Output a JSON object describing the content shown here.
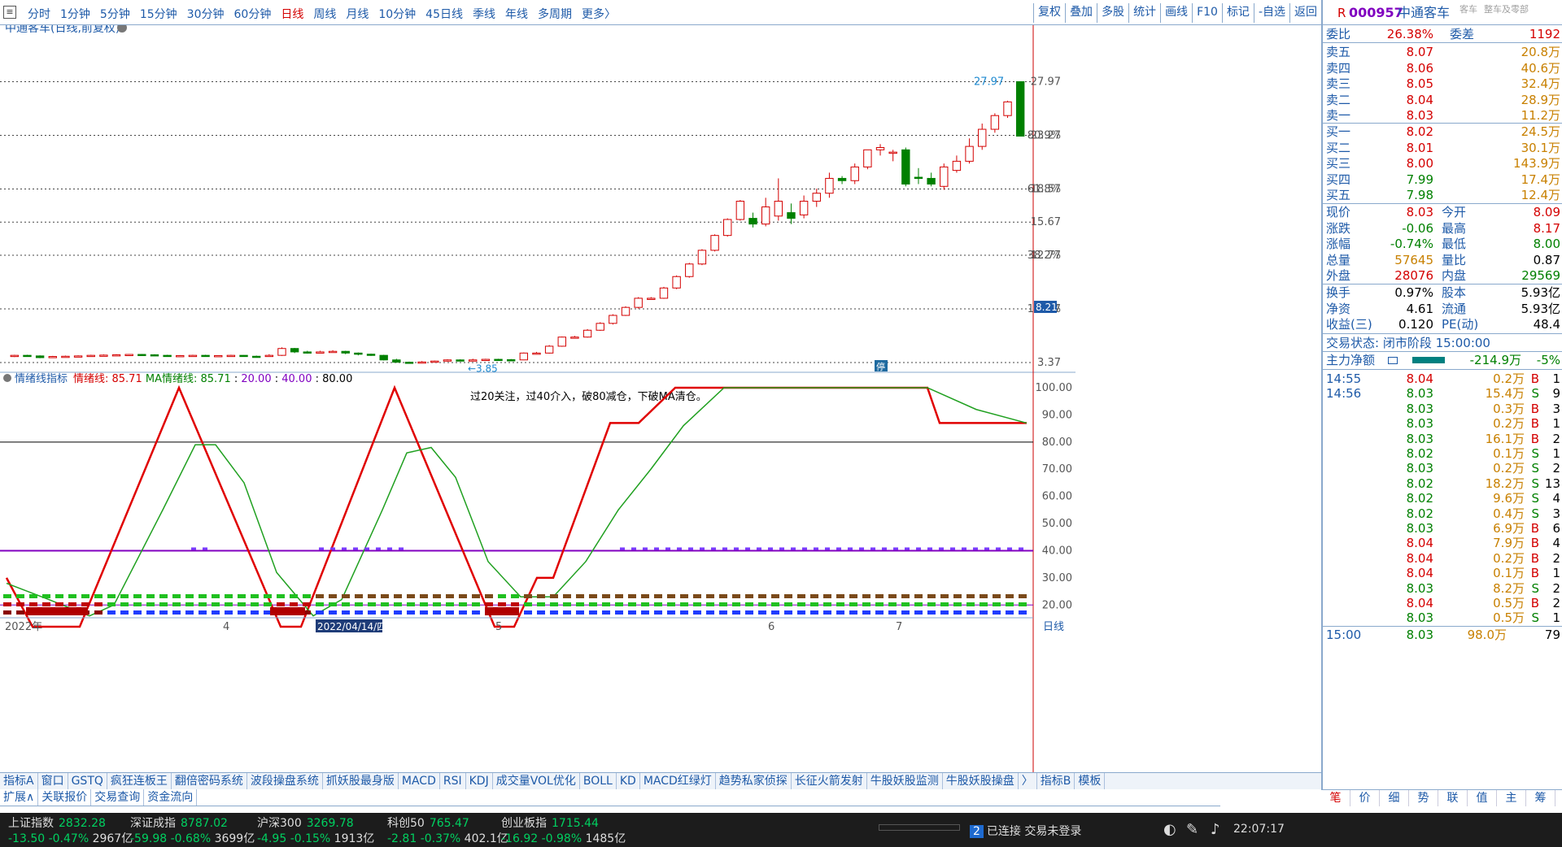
{
  "periods": [
    "分时",
    "1分钟",
    "5分钟",
    "15分钟",
    "30分钟",
    "60分钟",
    "日线",
    "周线",
    "月线",
    "10分钟",
    "45日线",
    "季线",
    "年线",
    "多周期",
    "更多〉"
  ],
  "active_period": "日线",
  "tools": [
    "复权",
    "叠加",
    "多股",
    "统计",
    "画线",
    "F10",
    "标记",
    "-自选",
    "返回"
  ],
  "chart_title": "中通客车(日线,前复权)",
  "price_axis": [
    "27.97",
    "23.27",
    "18.57",
    "15.67",
    "12.77",
    "8.07",
    "3.37"
  ],
  "pct_axis": [
    "80.9%",
    "61.8%",
    "38.2%",
    "19.1%"
  ],
  "current_price_tag": "8.21",
  "low_label": "3.85",
  "high_label": "27.97",
  "indicator": {
    "name": "情绪线指标",
    "l1": "情绪线:",
    "v1": "85.71",
    "l2": "MA情绪线:",
    "v2": "85.71",
    "lv3": "20.00",
    "lv4": "40.00",
    "lv5": "80.00",
    "note": "过20关注，过40介入，破80减仓，下破MA清仓。"
  },
  "ind_axis": [
    "100.00",
    "90.00",
    "80.00",
    "70.00",
    "60.00",
    "50.00",
    "40.00",
    "30.00",
    "20.00"
  ],
  "date_axis": {
    "year": "2022年",
    "m4": "4",
    "cursor": "2022/04/14/四",
    "m5": "5",
    "m6": "6",
    "m7": "7",
    "period": "日线"
  },
  "tabs1": [
    "指标A",
    "窗口",
    "GSTQ",
    "疯狂连板王",
    "翻倍密码系统",
    "波段操盘系统",
    "抓妖股最身版",
    "MACD",
    "RSI",
    "KDJ",
    "成交量VOL优化",
    "BOLL",
    "KD",
    "MACD红绿灯",
    "趋势私家侦探",
    "长征火箭发射",
    "牛股妖股监测",
    "牛股妖股操盘",
    "〉",
    "指标B",
    "模板"
  ],
  "tabs2": [
    "扩展∧",
    "关联报价",
    "交易查询",
    "资金流向"
  ],
  "rp_tabs": [
    "笔",
    "价",
    "细",
    "势",
    "联",
    "值",
    "主",
    "筹"
  ],
  "stock": {
    "code": "000957",
    "name": "中通客车",
    "tag1": "客车",
    "tag2": "整车及零部"
  },
  "weibi": {
    "l": "委比",
    "v": "26.38%",
    "l2": "委差",
    "v2": "1192"
  },
  "sells": [
    {
      "l": "卖五",
      "p": "8.07",
      "v": "20.8万"
    },
    {
      "l": "卖四",
      "p": "8.06",
      "v": "40.6万"
    },
    {
      "l": "卖三",
      "p": "8.05",
      "v": "32.4万"
    },
    {
      "l": "卖二",
      "p": "8.04",
      "v": "28.9万"
    },
    {
      "l": "卖一",
      "p": "8.03",
      "v": "11.2万"
    }
  ],
  "buys": [
    {
      "l": "买一",
      "p": "8.02",
      "v": "24.5万"
    },
    {
      "l": "买二",
      "p": "8.01",
      "v": "30.1万"
    },
    {
      "l": "买三",
      "p": "8.00",
      "v": "143.9万"
    },
    {
      "l": "买四",
      "p": "7.99",
      "v": "17.4万"
    },
    {
      "l": "买五",
      "p": "7.98",
      "v": "12.4万"
    }
  ],
  "quote": [
    {
      "a": "现价",
      "av": "8.03",
      "b": "今开",
      "bv": "8.09",
      "ac": "red",
      "bc": "red"
    },
    {
      "a": "涨跌",
      "av": "-0.06",
      "b": "最高",
      "bv": "8.17",
      "ac": "grn",
      "bc": "red"
    },
    {
      "a": "涨幅",
      "av": "-0.74%",
      "b": "最低",
      "bv": "8.00",
      "ac": "grn",
      "bc": "grn"
    },
    {
      "a": "总量",
      "av": "57645",
      "b": "量比",
      "bv": "0.87",
      "ac": "org",
      "bc": "blk"
    },
    {
      "a": "外盘",
      "av": "28076",
      "b": "内盘",
      "bv": "29569",
      "ac": "red",
      "bc": "grn"
    }
  ],
  "quote2": [
    {
      "a": "换手",
      "av": "0.97%",
      "b": "股本",
      "bv": "5.93亿"
    },
    {
      "a": "净资",
      "av": "4.61",
      "b": "流通",
      "bv": "5.93亿"
    },
    {
      "a": "收益(三)",
      "av": "0.120",
      "b": "PE(动)",
      "bv": "48.4"
    }
  ],
  "trade_status": "交易状态: 闭市阶段 15:00:00",
  "mainflow": {
    "l": "主力净额",
    "v": "-214.9万",
    "p": "-5%"
  },
  "ticks": [
    {
      "t": "14:55",
      "p": "8.04",
      "v": "0.2万",
      "s": "B",
      "n": "1"
    },
    {
      "t": "14:56",
      "p": "8.03",
      "v": "15.4万",
      "s": "S",
      "n": "9"
    },
    {
      "t": "",
      "p": "8.03",
      "v": "0.3万",
      "s": "B",
      "n": "3"
    },
    {
      "t": "",
      "p": "8.03",
      "v": "0.2万",
      "s": "B",
      "n": "1"
    },
    {
      "t": "",
      "p": "8.03",
      "v": "16.1万",
      "s": "B",
      "n": "2"
    },
    {
      "t": "",
      "p": "8.02",
      "v": "0.1万",
      "s": "S",
      "n": "1"
    },
    {
      "t": "",
      "p": "8.03",
      "v": "0.2万",
      "s": "S",
      "n": "2"
    },
    {
      "t": "",
      "p": "8.02",
      "v": "18.2万",
      "s": "S",
      "n": "13"
    },
    {
      "t": "",
      "p": "8.02",
      "v": "9.6万",
      "s": "S",
      "n": "4"
    },
    {
      "t": "",
      "p": "8.02",
      "v": "0.4万",
      "s": "S",
      "n": "3"
    },
    {
      "t": "",
      "p": "8.03",
      "v": "6.9万",
      "s": "B",
      "n": "6"
    },
    {
      "t": "",
      "p": "8.04",
      "v": "7.9万",
      "s": "B",
      "n": "4"
    },
    {
      "t": "",
      "p": "8.04",
      "v": "0.2万",
      "s": "B",
      "n": "2"
    },
    {
      "t": "",
      "p": "8.04",
      "v": "0.1万",
      "s": "B",
      "n": "1"
    },
    {
      "t": "",
      "p": "8.03",
      "v": "8.2万",
      "s": "S",
      "n": "2"
    },
    {
      "t": "",
      "p": "8.04",
      "v": "0.5万",
      "s": "B",
      "n": "2"
    },
    {
      "t": "",
      "p": "8.03",
      "v": "0.5万",
      "s": "S",
      "n": "1"
    }
  ],
  "last_tick": {
    "t": "15:00",
    "p": "8.03",
    "v": "98.0万",
    "n": "79"
  },
  "status_bar": [
    {
      "n": "上证指数",
      "v": "2832.28",
      "c": "-13.50",
      "p": "-0.47%",
      "a": "2967亿"
    },
    {
      "n": "深证成指",
      "v": "8787.02",
      "c": "-59.98",
      "p": "-0.68%",
      "a": "3699亿"
    },
    {
      "n": "沪深300",
      "v": "3269.78",
      "c": "-4.95",
      "p": "-0.15%",
      "a": "1913亿"
    },
    {
      "n": "科创50",
      "v": "765.47",
      "c": "-2.81",
      "p": "-0.37%",
      "a": "402.1亿"
    },
    {
      "n": "创业板指",
      "v": "1715.44",
      "c": "-16.92",
      "p": "-0.98%",
      "a": "1485亿"
    }
  ],
  "conn": {
    "num": "2",
    "text": "已连接",
    "login": "交易未登录",
    "time": "22:07:17"
  },
  "chart_data": {
    "type": "candlestick",
    "candles": [
      [
        3.9,
        4.0,
        3.85,
        4.05
      ],
      [
        4.0,
        3.95,
        3.9,
        4.05
      ],
      [
        3.95,
        3.8,
        3.75,
        4.0
      ],
      [
        3.85,
        3.9,
        3.8,
        3.95
      ],
      [
        3.9,
        3.92,
        3.85,
        3.98
      ],
      [
        3.92,
        3.95,
        3.88,
        4.0
      ],
      [
        3.95,
        4.0,
        3.9,
        4.05
      ],
      [
        4.0,
        4.02,
        3.95,
        4.08
      ],
      [
        4.02,
        4.05,
        3.98,
        4.1
      ],
      [
        4.05,
        4.08,
        4.0,
        4.12
      ],
      [
        4.08,
        4.05,
        4.0,
        4.12
      ],
      [
        4.05,
        4.0,
        3.95,
        4.1
      ],
      [
        4.0,
        3.95,
        3.9,
        4.05
      ],
      [
        3.95,
        3.98,
        3.9,
        4.02
      ],
      [
        3.98,
        4.0,
        3.92,
        4.05
      ],
      [
        4.0,
        3.95,
        3.9,
        4.05
      ],
      [
        3.95,
        3.98,
        3.9,
        4.0
      ],
      [
        3.98,
        4.0,
        3.92,
        4.05
      ],
      [
        4.0,
        3.92,
        3.88,
        4.02
      ],
      [
        3.92,
        3.9,
        3.85,
        3.98
      ],
      [
        3.9,
        4.0,
        3.88,
        4.1
      ],
      [
        4.0,
        4.6,
        3.95,
        4.7
      ],
      [
        4.6,
        4.3,
        4.2,
        4.65
      ],
      [
        4.3,
        4.25,
        4.15,
        4.4
      ],
      [
        4.25,
        4.3,
        4.2,
        4.4
      ],
      [
        4.3,
        4.35,
        4.25,
        4.45
      ],
      [
        4.35,
        4.2,
        4.1,
        4.4
      ],
      [
        4.2,
        4.1,
        4.0,
        4.25
      ],
      [
        4.1,
        4.0,
        3.95,
        4.15
      ],
      [
        4.0,
        3.6,
        3.55,
        4.05
      ],
      [
        3.6,
        3.4,
        3.35,
        3.7
      ],
      [
        3.4,
        3.38,
        3.3,
        3.45
      ],
      [
        3.38,
        3.42,
        3.3,
        3.5
      ],
      [
        3.42,
        3.5,
        3.4,
        3.55
      ],
      [
        3.5,
        3.6,
        3.45,
        3.65
      ],
      [
        3.6,
        3.55,
        3.5,
        3.65
      ],
      [
        3.55,
        3.6,
        3.5,
        3.7
      ],
      [
        3.6,
        3.65,
        3.55,
        3.7
      ],
      [
        3.65,
        3.62,
        3.55,
        3.7
      ],
      [
        3.62,
        3.6,
        3.55,
        3.68
      ],
      [
        3.6,
        4.2,
        3.58,
        4.25
      ],
      [
        4.2,
        4.2,
        4.1,
        4.3
      ],
      [
        4.2,
        4.8,
        4.15,
        4.9
      ],
      [
        4.8,
        5.6,
        4.75,
        5.65
      ],
      [
        5.6,
        5.6,
        5.55,
        5.7
      ],
      [
        5.6,
        6.2,
        5.55,
        6.3
      ],
      [
        6.2,
        6.8,
        6.15,
        6.9
      ],
      [
        6.8,
        7.5,
        6.7,
        7.6
      ],
      [
        7.5,
        8.2,
        7.45,
        8.3
      ],
      [
        8.2,
        9.0,
        8.1,
        9.1
      ],
      [
        9.0,
        9.0,
        8.95,
        9.1
      ],
      [
        9.0,
        9.9,
        8.95,
        10.0
      ],
      [
        9.9,
        10.9,
        9.8,
        11.0
      ],
      [
        10.9,
        12.0,
        10.8,
        12.1
      ],
      [
        12.0,
        13.2,
        11.9,
        13.3
      ],
      [
        13.2,
        14.5,
        13.1,
        14.6
      ],
      [
        14.5,
        15.9,
        14.4,
        16.0
      ],
      [
        15.9,
        17.5,
        15.8,
        17.6
      ],
      [
        16.0,
        15.5,
        15.2,
        16.5
      ],
      [
        15.5,
        17.0,
        15.3,
        17.8
      ],
      [
        16.2,
        17.5,
        15.8,
        19.5
      ],
      [
        16.5,
        16.0,
        15.5,
        17.3
      ],
      [
        16.3,
        17.5,
        16.0,
        18.0
      ],
      [
        17.5,
        18.2,
        17.0,
        18.6
      ],
      [
        18.2,
        19.5,
        17.8,
        20.0
      ],
      [
        19.5,
        19.3,
        19.0,
        19.7
      ],
      [
        19.3,
        20.5,
        19.0,
        20.8
      ],
      [
        20.5,
        22.0,
        20.3,
        22.0
      ],
      [
        22.0,
        22.2,
        21.5,
        22.5
      ],
      [
        21.8,
        21.8,
        21.0,
        22.0
      ],
      [
        22.0,
        19.0,
        18.8,
        22.2
      ],
      [
        19.6,
        19.5,
        19.0,
        20.4
      ],
      [
        19.5,
        19.0,
        18.8,
        20.0
      ],
      [
        18.8,
        20.5,
        18.5,
        20.8
      ],
      [
        20.2,
        21.0,
        20.0,
        21.5
      ],
      [
        21.0,
        22.3,
        20.8,
        23.0
      ],
      [
        22.3,
        23.8,
        22.0,
        24.3
      ],
      [
        23.8,
        25.0,
        23.5,
        25.2
      ],
      [
        25.0,
        26.2,
        24.8,
        26.3
      ],
      [
        27.97,
        23.2,
        23.2,
        27.97
      ]
    ],
    "ind_red": [
      29,
      28,
      25,
      23,
      21,
      19,
      17,
      15,
      13,
      12,
      11,
      10,
      10,
      10,
      10,
      10,
      12,
      14,
      16,
      18,
      20,
      22,
      24,
      26,
      28,
      30,
      32,
      34,
      37,
      40,
      43,
      46,
      49,
      52,
      55,
      58,
      61,
      64,
      67,
      70,
      73,
      76,
      79,
      82,
      85,
      88,
      91,
      94,
      97,
      100
    ],
    "ylim": [
      3.37,
      29
    ]
  }
}
